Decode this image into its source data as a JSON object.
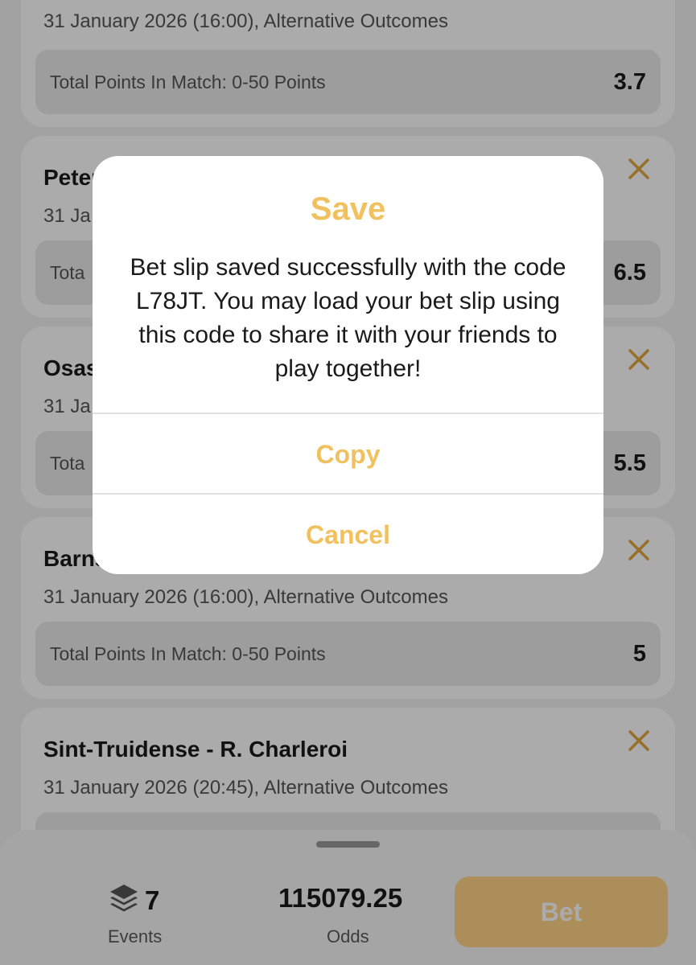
{
  "cards": [
    {
      "title": "",
      "subtitle": "31 January 2026 (16:00), Alternative Outcomes",
      "selection": "Total Points In Match: 0-50 Points",
      "odds": "3.7"
    },
    {
      "title": "Peter",
      "subtitle": "31 Ja",
      "selection": "Tota",
      "odds": "6.5"
    },
    {
      "title": "Osas",
      "subtitle": "31 Ja",
      "selection": "Tota",
      "odds": "5.5"
    },
    {
      "title": "Barns",
      "subtitle": "31 January 2026 (16:00), Alternative Outcomes",
      "selection": "Total Points In Match: 0-50 Points",
      "odds": "5"
    },
    {
      "title": "Sint-Truidense - R. Charleroi",
      "subtitle": "31 January 2026 (20:45), Alternative Outcomes",
      "selection": "",
      "odds": ""
    }
  ],
  "bottom_bar": {
    "events_count": "7",
    "events_label": "Events",
    "odds_value": "115079.25",
    "odds_label": "Odds",
    "bet_label": "Bet"
  },
  "dialog": {
    "title": "Save",
    "message": "Bet slip saved successfully with the code L78JT. You may load your bet slip using this code to share it with your friends to play together!",
    "copy_label": "Copy",
    "cancel_label": "Cancel"
  },
  "icons": {
    "close": "close-icon",
    "events": "stack-layers-icon"
  },
  "colors": {
    "accent": "#f2c15f",
    "bet_button": "#ffd485",
    "background": "#f2f2f2",
    "card": "#ffffff"
  }
}
